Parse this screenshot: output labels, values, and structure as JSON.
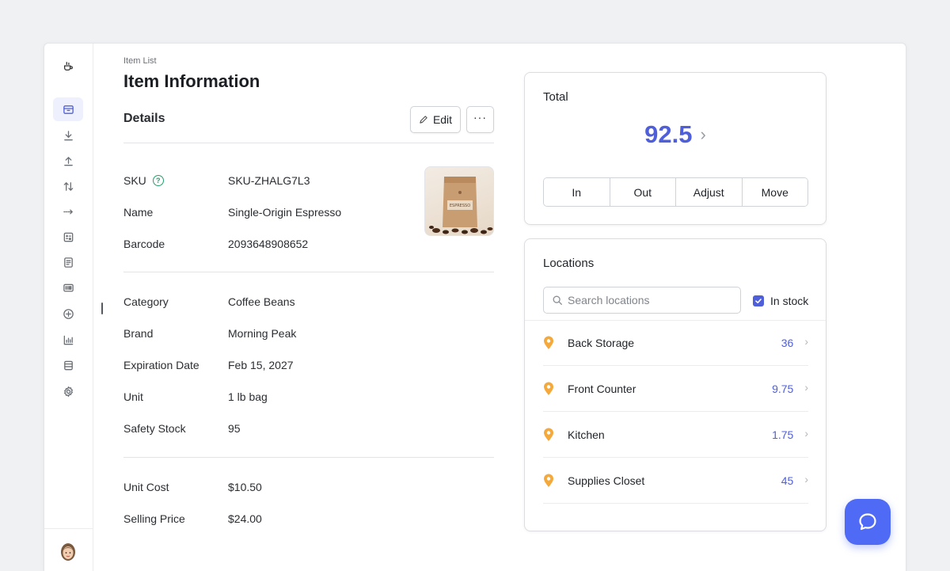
{
  "sidebar": {
    "logo_icon": "coffee-cup-icon",
    "items": [
      {
        "name": "items",
        "icon": "box-icon",
        "active": true
      },
      {
        "name": "stock-in",
        "icon": "download-icon"
      },
      {
        "name": "stock-out",
        "icon": "upload-icon"
      },
      {
        "name": "adjust",
        "icon": "arrows-updown-icon"
      },
      {
        "name": "move",
        "icon": "arrow-right-dashed-icon"
      },
      {
        "name": "counts",
        "icon": "calculator-icon"
      },
      {
        "name": "documents",
        "icon": "document-icon"
      },
      {
        "name": "barcodes",
        "icon": "barcode-icon"
      },
      {
        "name": "add",
        "icon": "plus-circle-icon"
      },
      {
        "name": "reports",
        "icon": "bar-chart-icon"
      },
      {
        "name": "data",
        "icon": "table-icon"
      },
      {
        "name": "settings",
        "icon": "gear-icon"
      }
    ]
  },
  "header": {
    "breadcrumb": "Item List",
    "title": "Item Information"
  },
  "details": {
    "section_title": "Details",
    "edit_label": "Edit",
    "more_label": "···",
    "fields": [
      {
        "label": "SKU",
        "value": "SKU-ZHALG7L3",
        "help": true
      },
      {
        "label": "Name",
        "value": "Single-Origin Espresso"
      },
      {
        "label": "Barcode",
        "value": "2093648908652"
      },
      {
        "label": "Category",
        "value": "Coffee Beans"
      },
      {
        "label": "Brand",
        "value": "Morning Peak"
      },
      {
        "label": "Expiration Date",
        "value": "Feb 15, 2027"
      },
      {
        "label": "Unit",
        "value": "1 lb bag"
      },
      {
        "label": "Safety Stock",
        "value": "95"
      },
      {
        "label": "Unit Cost",
        "value": "$10.50"
      },
      {
        "label": "Selling Price",
        "value": "$24.00"
      }
    ],
    "image_label": "ESPRESSO",
    "help_glyph": "?"
  },
  "total": {
    "title": "Total",
    "value": "92.5",
    "chevron": "›",
    "actions": [
      "In",
      "Out",
      "Adjust",
      "Move"
    ]
  },
  "locations": {
    "title": "Locations",
    "search_placeholder": "Search locations",
    "filter_label": "In stock",
    "filter_checked": true,
    "items": [
      {
        "name": "Back Storage",
        "qty": "36"
      },
      {
        "name": "Front Counter",
        "qty": "9.75"
      },
      {
        "name": "Kitchen",
        "qty": "1.75"
      },
      {
        "name": "Supplies Closet",
        "qty": "45"
      }
    ],
    "chevron": "›"
  },
  "colors": {
    "accent": "#4f5fd9",
    "pin": "#f4a93a",
    "help": "#24a06b",
    "chat": "#4f6bf6"
  }
}
